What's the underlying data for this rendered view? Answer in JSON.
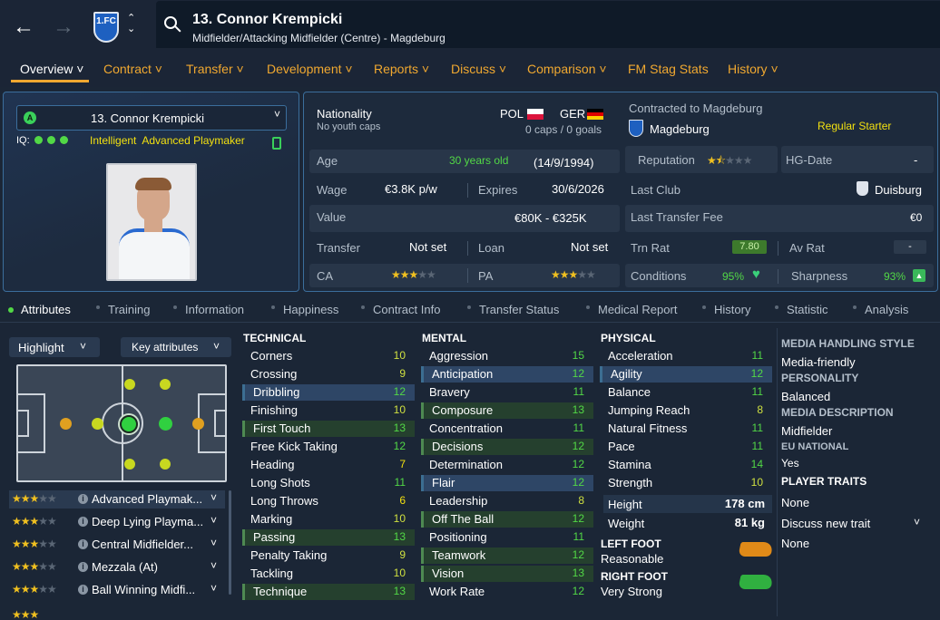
{
  "header": {
    "name": "13. Connor Krempicki",
    "subtitle": "Midfielder/Attacking Midfielder (Centre) - Magdeburg"
  },
  "nav": [
    "Overview",
    "Contract",
    "Transfer",
    "Development",
    "Reports",
    "Discuss",
    "Comparison",
    "FM Stag Stats",
    "History"
  ],
  "profile": {
    "name": "13. Connor Krempicki",
    "iq_label": "IQ:",
    "style": "Intelligent  Advanced Playmaker"
  },
  "bio": {
    "nationality_label": "Nationality",
    "caps_note": "No youth caps",
    "nat1": "POL",
    "nat2": "GER",
    "caps": "0 caps / 0 goals",
    "age_label": "Age",
    "age": "30 years old",
    "dob": "(14/9/1994)",
    "wage_label": "Wage",
    "wage": "€3.8K p/w",
    "expires_label": "Expires",
    "expires": "30/6/2026",
    "value_label": "Value",
    "value": "€80K - €325K",
    "transfer_label": "Transfer",
    "transfer": "Not set",
    "loan_label": "Loan",
    "loan": "Not set",
    "ca_label": "CA",
    "pa_label": "PA"
  },
  "club": {
    "contract_label": "Contracted to Magdeburg",
    "club": "Magdeburg",
    "role": "Regular Starter",
    "rep_label": "Reputation",
    "hg_label": "HG-Date",
    "hg": "-",
    "last_club_label": "Last Club",
    "last_club": "Duisburg",
    "fee_label": "Last Transfer Fee",
    "fee": "€0",
    "trn_label": "Trn Rat",
    "trn": "7.80",
    "av_label": "Av Rat",
    "av": "-",
    "cond_label": "Conditions",
    "cond": "95%",
    "sharp_label": "Sharpness",
    "sharp": "93%"
  },
  "subtabs": [
    "Attributes",
    "Training",
    "Information",
    "Happiness",
    "Contract Info",
    "Transfer Status",
    "Medical Report",
    "History",
    "Statistic",
    "Analysis"
  ],
  "controls": {
    "highlight": "Highlight",
    "key": "Key attributes"
  },
  "roles": [
    {
      "name": "Advanced Playmak...",
      "stars": 3
    },
    {
      "name": "Deep Lying Playma...",
      "stars": 3
    },
    {
      "name": "Central Midfielder...",
      "stars": 3
    },
    {
      "name": "Mezzala (At)",
      "stars": 3
    },
    {
      "name": "Ball Winning Midfi...",
      "stars": 3
    }
  ],
  "technical": {
    "title": "TECHNICAL",
    "items": [
      {
        "name": "Corners",
        "value": 10
      },
      {
        "name": "Crossing",
        "value": 9
      },
      {
        "name": "Dribbling",
        "value": 12
      },
      {
        "name": "Finishing",
        "value": 10
      },
      {
        "name": "First Touch",
        "value": 13
      },
      {
        "name": "Free Kick Taking",
        "value": 12
      },
      {
        "name": "Heading",
        "value": 7
      },
      {
        "name": "Long Shots",
        "value": 11
      },
      {
        "name": "Long Throws",
        "value": 6
      },
      {
        "name": "Marking",
        "value": 10
      },
      {
        "name": "Passing",
        "value": 13
      },
      {
        "name": "Penalty Taking",
        "value": 9
      },
      {
        "name": "Tackling",
        "value": 10
      },
      {
        "name": "Technique",
        "value": 13
      }
    ]
  },
  "mental": {
    "title": "MENTAL",
    "items": [
      {
        "name": "Aggression",
        "value": 15
      },
      {
        "name": "Anticipation",
        "value": 12
      },
      {
        "name": "Bravery",
        "value": 11
      },
      {
        "name": "Composure",
        "value": 13
      },
      {
        "name": "Concentration",
        "value": 11
      },
      {
        "name": "Decisions",
        "value": 12
      },
      {
        "name": "Determination",
        "value": 12
      },
      {
        "name": "Flair",
        "value": 12
      },
      {
        "name": "Leadership",
        "value": 8
      },
      {
        "name": "Off The Ball",
        "value": 12
      },
      {
        "name": "Positioning",
        "value": 11
      },
      {
        "name": "Teamwork",
        "value": 12
      },
      {
        "name": "Vision",
        "value": 13
      },
      {
        "name": "Work Rate",
        "value": 12
      }
    ]
  },
  "physical": {
    "title": "PHYSICAL",
    "items": [
      {
        "name": "Acceleration",
        "value": 11
      },
      {
        "name": "Agility",
        "value": 12
      },
      {
        "name": "Balance",
        "value": 11
      },
      {
        "name": "Jumping Reach",
        "value": 8
      },
      {
        "name": "Natural Fitness",
        "value": 11
      },
      {
        "name": "Pace",
        "value": 11
      },
      {
        "name": "Stamina",
        "value": 14
      },
      {
        "name": "Strength",
        "value": 10
      }
    ]
  },
  "body": {
    "height_label": "Height",
    "height": "178 cm",
    "weight_label": "Weight",
    "weight": "81 kg",
    "lf_label": "LEFT FOOT",
    "lf": "Reasonable",
    "rf_label": "RIGHT FOOT",
    "rf": "Very Strong"
  },
  "side": {
    "mhs_label": "MEDIA HANDLING STYLE",
    "mhs": "Media-friendly",
    "pers_label": "PERSONALITY",
    "pers": "Balanced",
    "md_label": "MEDIA DESCRIPTION",
    "md": "Midfielder",
    "eu_label": "EU NATIONAL",
    "eu": "Yes",
    "traits_label": "PLAYER TRAITS",
    "traits": "None",
    "discuss": "Discuss new trait",
    "none2": "None"
  },
  "colors": {
    "accent": "#f0a830",
    "good": "#52d846",
    "mid": "#f2e010",
    "panel_border": "#3b6e9c"
  }
}
